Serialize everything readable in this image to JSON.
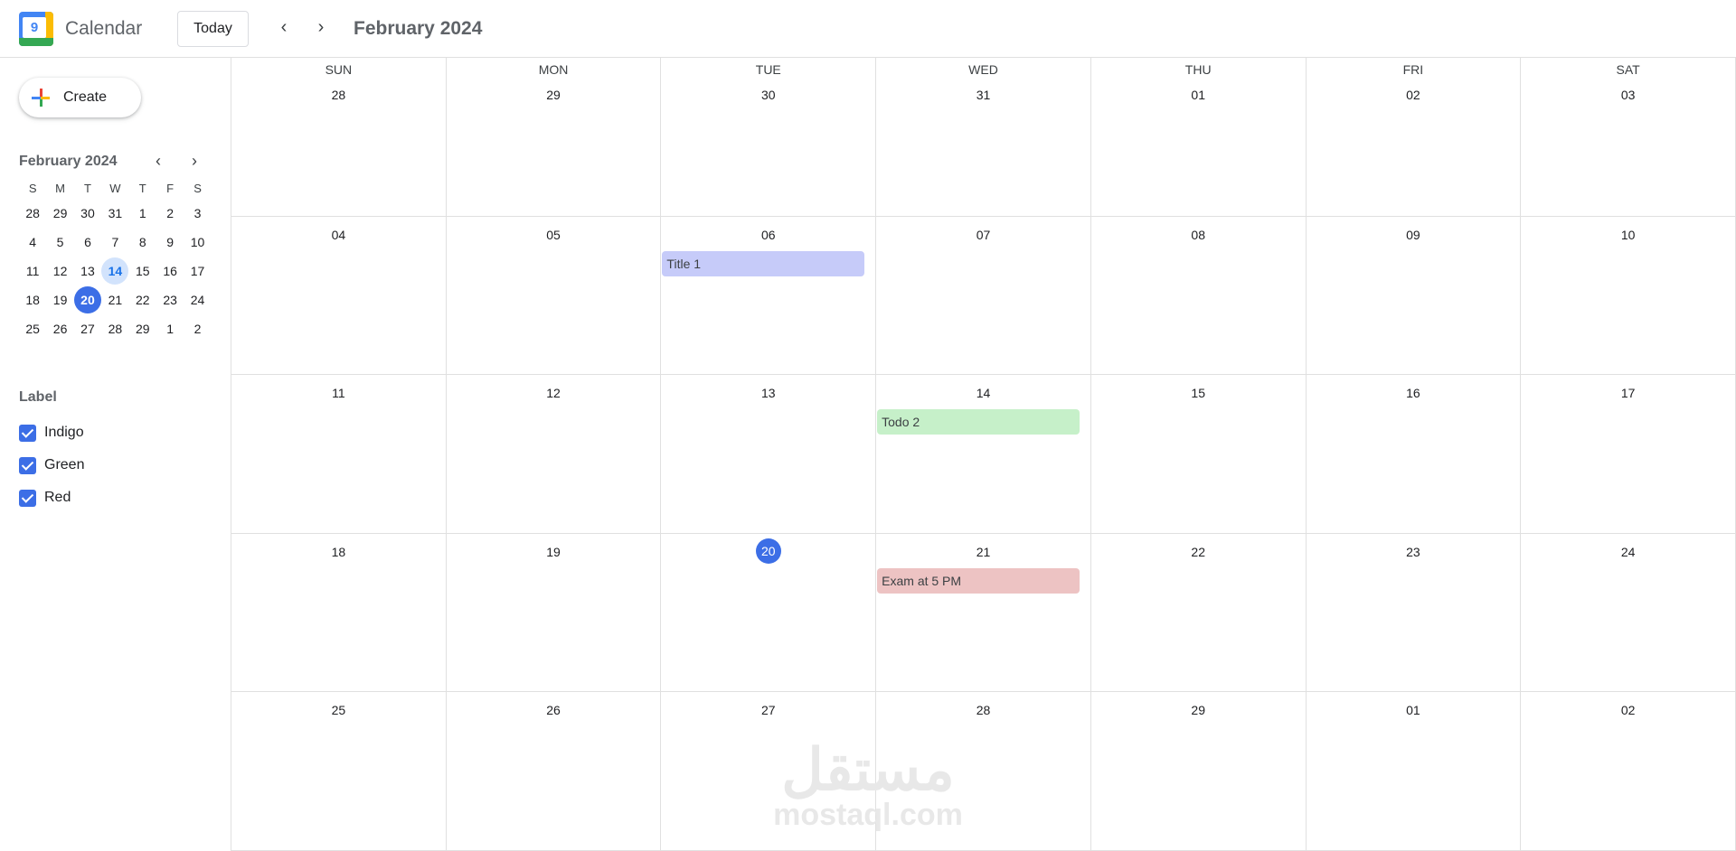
{
  "header": {
    "logo_number": "9",
    "app_title": "Calendar",
    "today_label": "Today",
    "prev_icon": "‹",
    "next_icon": "›",
    "month_label": "February 2024"
  },
  "sidebar": {
    "create_label": "Create",
    "mini_month_label": "February 2024",
    "mini_prev_icon": "‹",
    "mini_next_icon": "›",
    "weekday_initials": [
      "S",
      "M",
      "T",
      "W",
      "T",
      "F",
      "S"
    ],
    "weeks": [
      [
        "28",
        "29",
        "30",
        "31",
        "1",
        "2",
        "3"
      ],
      [
        "4",
        "5",
        "6",
        "7",
        "8",
        "9",
        "10"
      ],
      [
        "11",
        "12",
        "13",
        "14",
        "15",
        "16",
        "17"
      ],
      [
        "18",
        "19",
        "20",
        "21",
        "22",
        "23",
        "24"
      ],
      [
        "25",
        "26",
        "27",
        "28",
        "29",
        "1",
        "2"
      ]
    ],
    "today_day": "20",
    "selected_day": "14",
    "label_heading": "Label",
    "labels": [
      {
        "name": "Indigo",
        "checked": true
      },
      {
        "name": "Green",
        "checked": true
      },
      {
        "name": "Red",
        "checked": true
      }
    ]
  },
  "month_grid": {
    "day_headers": [
      "SUN",
      "MON",
      "TUE",
      "WED",
      "THU",
      "FRI",
      "SAT"
    ],
    "weeks": [
      [
        "28",
        "29",
        "30",
        "31",
        "01",
        "02",
        "03"
      ],
      [
        "04",
        "05",
        "06",
        "07",
        "08",
        "09",
        "10"
      ],
      [
        "11",
        "12",
        "13",
        "14",
        "15",
        "16",
        "17"
      ],
      [
        "18",
        "19",
        "20",
        "21",
        "22",
        "23",
        "24"
      ],
      [
        "25",
        "26",
        "27",
        "28",
        "29",
        "01",
        "02"
      ]
    ],
    "today": {
      "week": 3,
      "day": 2
    },
    "events": [
      {
        "title": "Title 1",
        "week": 1,
        "day": 2,
        "color": "#c6cbf9"
      },
      {
        "title": "Todo 2",
        "week": 2,
        "day": 3,
        "color": "#c6f0c9"
      },
      {
        "title": "Exam at 5 PM",
        "week": 3,
        "day": 3,
        "color": "#edc3c3"
      }
    ]
  },
  "watermark": {
    "arabic": "مستقل",
    "latin": "mostaql.com"
  },
  "colors": {
    "accent": "#3c6ee6",
    "indigo_event": "#c6cbf9",
    "green_event": "#c6f0c9",
    "red_event": "#edc3c3",
    "grid_line": "#e0e0e0"
  }
}
